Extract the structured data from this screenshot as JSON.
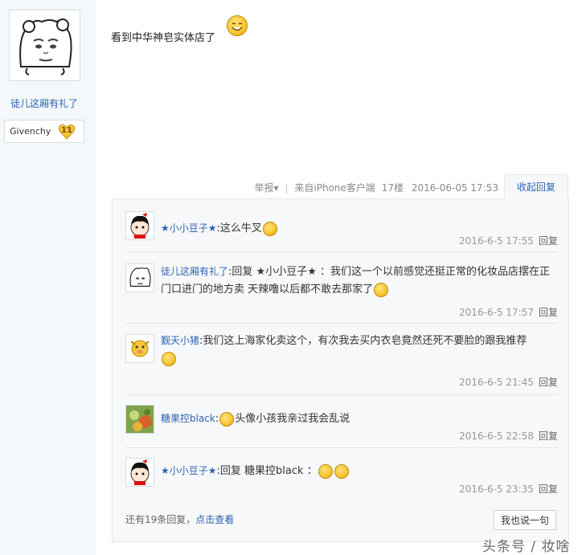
{
  "author": {
    "username": "徒儿这厢有礼了",
    "badge_name": "Givenchy",
    "badge_level": "11"
  },
  "post": {
    "text": "看到中华神皂实体店了"
  },
  "meta": {
    "report_label": "举报",
    "source_label": "来自iPhone客户端",
    "floor": "17楼",
    "datetime": "2016-06-05 17:53",
    "collapse_label": "收起回复"
  },
  "replies": [
    {
      "name": "★小小豆子★",
      "text": "这么牛叉",
      "time": "2016-6-5 17:55",
      "reply_label": "回复"
    },
    {
      "name": "徒儿这厢有礼了",
      "text": "回复 ★小小豆子★ ：我们这一个以前感觉还挺正常的化妆品店摆在正门口进门的地方卖 天辣噜以后都不敢去那家了",
      "time": "2016-6-5 17:57",
      "reply_label": "回复"
    },
    {
      "name": "觐天小猪",
      "text": "我们这上海家化卖这个，有次我去买内衣皂竟然还死不要脸的跟我推荐",
      "time": "2016-6-5 21:45",
      "reply_label": "回复"
    },
    {
      "name": "糖果控black",
      "text": "头像小孩我亲过我会乱说",
      "time": "2016-6-5 22:58",
      "reply_label": "回复"
    },
    {
      "name": "★小小豆子★",
      "text": "回复 糖果控black ：",
      "time": "2016-6-5 23:35",
      "reply_label": "回复"
    }
  ],
  "footer": {
    "more_text": "还有19条回复，",
    "more_link": "点击查看",
    "say_button": "我也说一句"
  },
  "watermark": "头条号 / 妆啥",
  "colors": {
    "link_blue": "#2d64b3",
    "sidebar_bg": "#f4f8fb",
    "reply_bg": "#f7f8fa",
    "muted_gray": "#999999"
  }
}
